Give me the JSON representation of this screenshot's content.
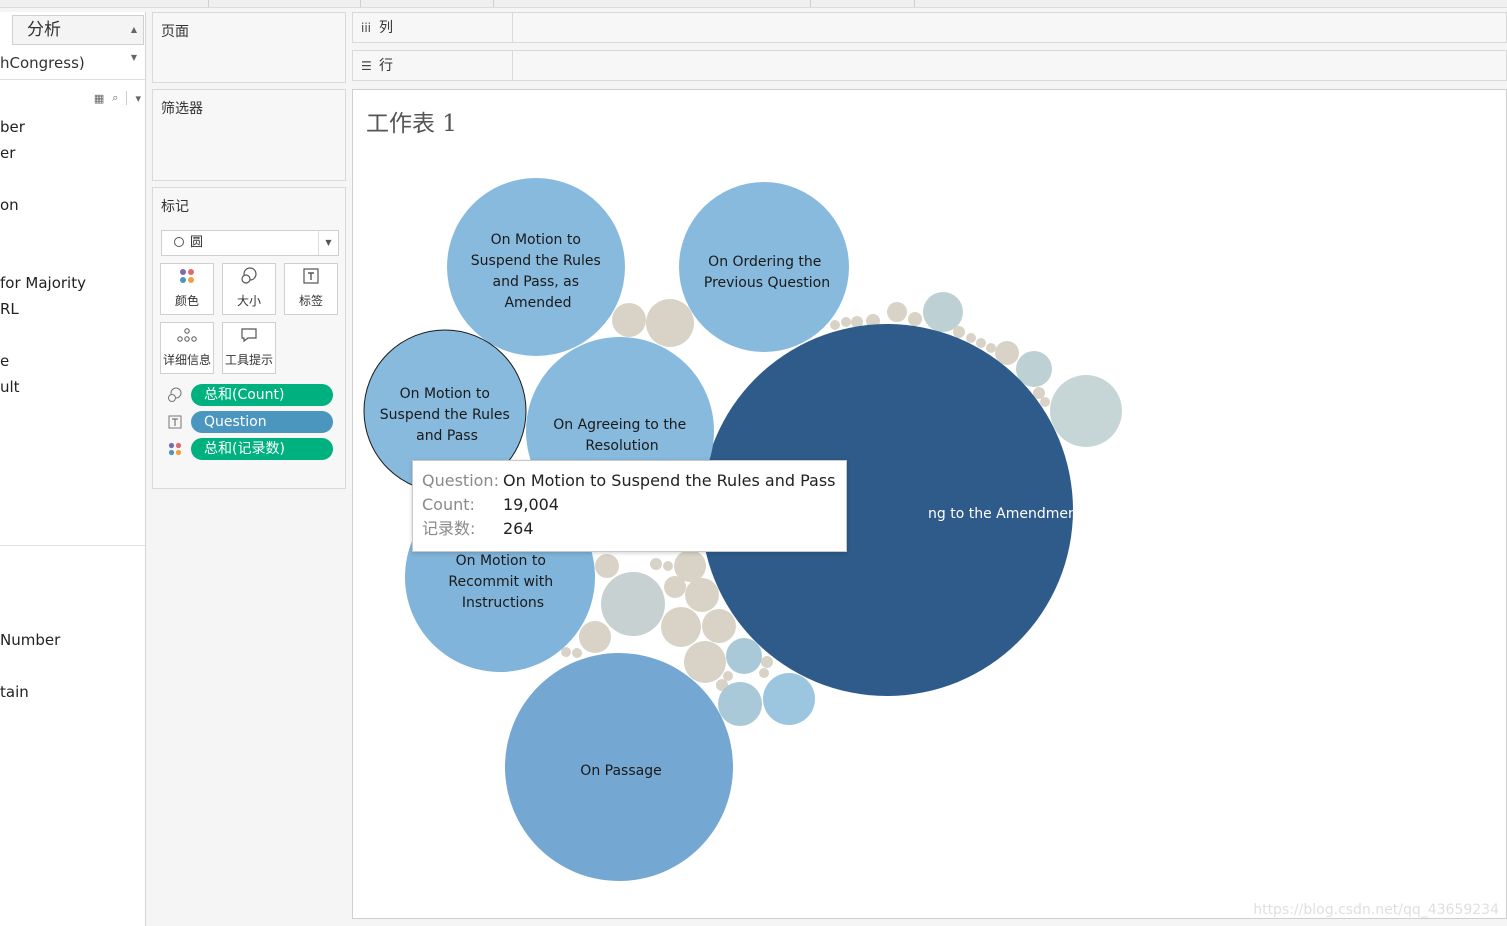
{
  "data_pane": {
    "analysis_tab": "分析",
    "datasource": "hCongress)",
    "fields": [
      "ber",
      "er",
      "on",
      " for Majority",
      "RL",
      "e",
      "ult",
      " Number",
      "tain"
    ]
  },
  "shelves": {
    "pages": "页面",
    "filters": "筛选器",
    "columns": "列",
    "rows": "行"
  },
  "marks": {
    "title": "标记",
    "mark_type": "圆",
    "buttons": {
      "color": "颜色",
      "size": "大小",
      "label": "标签",
      "detail": "详细信息",
      "tooltip": "工具提示"
    },
    "pills": [
      {
        "text": "总和(Count)",
        "icon": "size-icon",
        "color": "#00b180"
      },
      {
        "text": "Question",
        "icon": "label-icon",
        "color": "#4a96bf"
      },
      {
        "text": "总和(记录数)",
        "icon": "color-icon",
        "color": "#00b180"
      }
    ]
  },
  "sheet": {
    "title": "工作表 1"
  },
  "chart_data": {
    "type": "bubble",
    "title": "工作表 1",
    "size_measure": "总和(Count)",
    "color_measure": "总和(记录数)",
    "label_field": "Question",
    "labeled_bubbles": [
      {
        "lines": [
          "ng to the Amendment"
        ]
      },
      {
        "lines": [
          "On Motion to",
          "Suspend the Rules",
          "and Pass, as",
          "Amended"
        ]
      },
      {
        "lines": [
          "On Ordering the",
          "Previous Question"
        ]
      },
      {
        "lines": [
          "On Motion to",
          "Suspend the Rules",
          "and Pass"
        ]
      },
      {
        "lines": [
          "On Agreeing to the",
          "Resolution"
        ]
      },
      {
        "lines": [
          "On Motion to",
          "Recommit with",
          "Instructions"
        ]
      },
      {
        "lines": [
          "On Passage"
        ]
      }
    ],
    "tooltip": {
      "question_key": "Question:",
      "question": "On Motion to Suspend the Rules and Pass",
      "count_key": "Count:",
      "count": "19,004",
      "records_key": "记录数:",
      "records": "264"
    }
  },
  "watermark": "https://blog.csdn.net/qq_43659234"
}
